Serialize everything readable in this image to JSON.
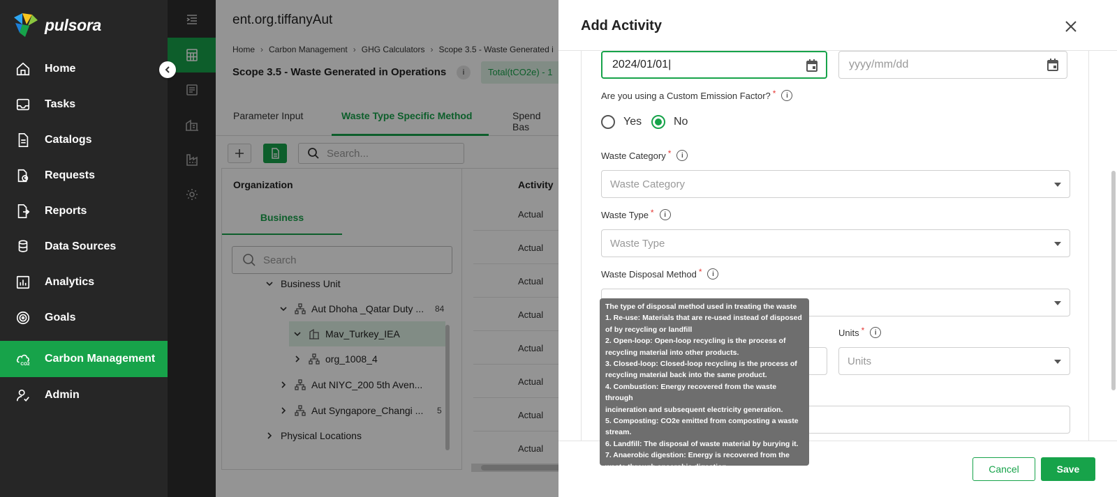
{
  "app": {
    "brand": "pulsora",
    "accent": "#17a34a"
  },
  "sidebar": {
    "items": [
      {
        "label": "Home",
        "icon": "home-icon"
      },
      {
        "label": "Tasks",
        "icon": "inbox-icon"
      },
      {
        "label": "Catalogs",
        "icon": "document-icon"
      },
      {
        "label": "Requests",
        "icon": "requests-icon"
      },
      {
        "label": "Reports",
        "icon": "reports-icon"
      },
      {
        "label": "Data Sources",
        "icon": "database-icon"
      },
      {
        "label": "Analytics",
        "icon": "chart-icon"
      },
      {
        "label": "Goals",
        "icon": "target-icon"
      },
      {
        "label": "Carbon Management",
        "icon": "co2-cloud-icon",
        "active": true
      },
      {
        "label": "Admin",
        "icon": "user-check-icon"
      }
    ]
  },
  "main": {
    "title": "ent.org.tiffanyAut",
    "breadcrumb": [
      "Home",
      "Carbon Management",
      "GHG Calculators",
      "Scope 3.5 - Waste Generated i"
    ],
    "scope_title": "Scope 3.5 - Waste Generated in Operations",
    "info_glyph": "i",
    "total": "Total(tCO2e) - 1",
    "tabs": [
      "Parameter Input",
      "Waste Type Specific Method",
      "Spend Bas"
    ],
    "search_placeholder": "Search...",
    "org_header": "Organization",
    "org_tab": "Business",
    "org_search_placeholder": "Search",
    "tree": [
      {
        "label": "Business Unit"
      },
      {
        "label": "Aut Dhoha _Qatar Duty ...",
        "count": "84"
      },
      {
        "label": "Mav_Turkey_IEA"
      },
      {
        "label": "org_1008_4"
      },
      {
        "label": "Aut NIYC_200 5th Aven..."
      },
      {
        "label": "Aut Syngapore_Changi ...",
        "count": "5"
      },
      {
        "label": "Physical Locations"
      }
    ],
    "activity_header": "Activity",
    "activity_rows": [
      "Actual",
      "Actual",
      "Actual",
      "Actual",
      "Actual",
      "Actual",
      "Actual",
      "Actual"
    ]
  },
  "drawer": {
    "title": "Add Activity",
    "start_date": "2024/01/01",
    "end_date_placeholder": "yyyy/mm/dd",
    "custom_ef_label": "Are you using a Custom Emission Factor?",
    "req_mark": "*",
    "info_glyph": "i",
    "radio_yes": "Yes",
    "radio_no": "No",
    "radio_selected": "No",
    "waste_category_label": "Waste Category",
    "waste_category_placeholder": "Waste Category",
    "waste_type_label": "Waste Type",
    "waste_type_placeholder": "Waste Type",
    "disposal_label": "Waste Disposal Method",
    "units_label": "Units",
    "units_placeholder": "Units",
    "tooltip_lines": [
      "The type of disposal method used in treating the waste",
      "1. Re-use: Materials that are re-used instead of disposed",
      "of by recycling or landfill",
      "2. Open-loop: Open-loop recycling is the process of",
      "recycling material into other products.",
      "3. Closed-loop: Closed-loop recycling is the process of",
      "recycling material back into the same product.",
      "4. Combustion: Energy recovered from the waste through",
      "incineration and subsequent electricity generation.",
      "5. Composting: CO2e emitted from composting a waste",
      "stream.",
      "6. Landfill: The disposal of waste material by burying it.",
      "7. Anaerobic digestion: Energy is recovered from the",
      "waste through anaerobic digestion."
    ],
    "cancel_label": "Cancel",
    "save_label": "Save"
  }
}
